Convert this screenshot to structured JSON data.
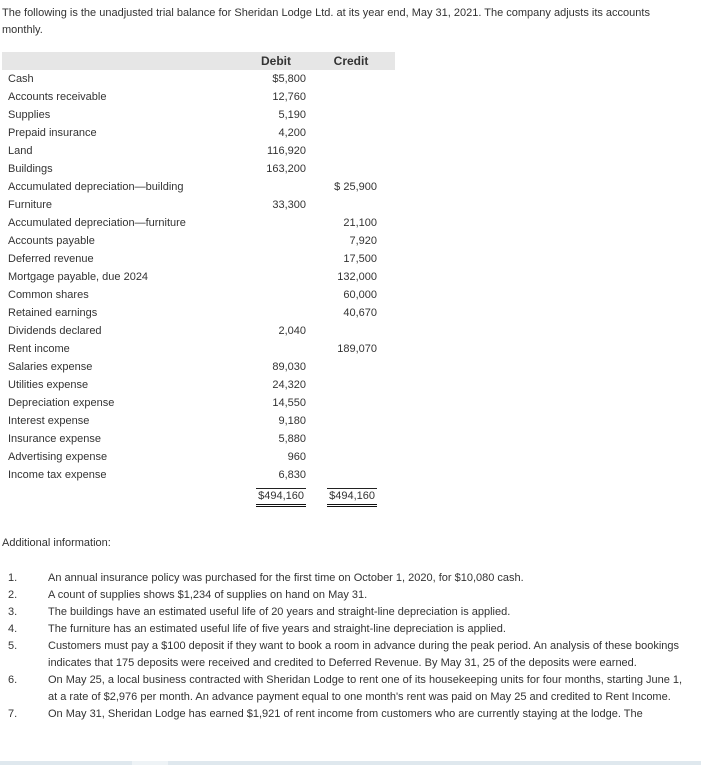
{
  "intro": "The following is the unadjusted trial balance for Sheridan Lodge Ltd. at its year end, May 31, 2021. The company adjusts its accounts monthly.",
  "trial_balance": {
    "headers": {
      "account": "",
      "debit": "Debit",
      "credit": "Credit"
    },
    "rows": [
      {
        "account": "Cash",
        "debit": "$5,800",
        "credit": ""
      },
      {
        "account": "Accounts receivable",
        "debit": "12,760",
        "credit": ""
      },
      {
        "account": "Supplies",
        "debit": "5,190",
        "credit": ""
      },
      {
        "account": "Prepaid insurance",
        "debit": "4,200",
        "credit": ""
      },
      {
        "account": "Land",
        "debit": "116,920",
        "credit": ""
      },
      {
        "account": "Buildings",
        "debit": "163,200",
        "credit": ""
      },
      {
        "account": "Accumulated depreciation—building",
        "debit": "",
        "credit": "$ 25,900"
      },
      {
        "account": "Furniture",
        "debit": "33,300",
        "credit": ""
      },
      {
        "account": "Accumulated depreciation—furniture",
        "debit": "",
        "credit": "21,100"
      },
      {
        "account": "Accounts payable",
        "debit": "",
        "credit": "7,920"
      },
      {
        "account": "Deferred revenue",
        "debit": "",
        "credit": "17,500"
      },
      {
        "account": "Mortgage payable, due 2024",
        "debit": "",
        "credit": "132,000"
      },
      {
        "account": "Common shares",
        "debit": "",
        "credit": "60,000"
      },
      {
        "account": "Retained earnings",
        "debit": "",
        "credit": "40,670"
      },
      {
        "account": "Dividends declared",
        "debit": "2,040",
        "credit": ""
      },
      {
        "account": "Rent income",
        "debit": "",
        "credit": "189,070"
      },
      {
        "account": "Salaries expense",
        "debit": "89,030",
        "credit": ""
      },
      {
        "account": "Utilities expense",
        "debit": "24,320",
        "credit": ""
      },
      {
        "account": "Depreciation expense",
        "debit": "14,550",
        "credit": ""
      },
      {
        "account": "Interest expense",
        "debit": "9,180",
        "credit": ""
      },
      {
        "account": "Insurance expense",
        "debit": "5,880",
        "credit": ""
      },
      {
        "account": "Advertising expense",
        "debit": "960",
        "credit": ""
      },
      {
        "account": "Income tax expense",
        "debit": "6,830",
        "credit": ""
      }
    ],
    "totals": {
      "debit": "$494,160",
      "credit": "$494,160"
    }
  },
  "additional": {
    "heading": "Additional information:",
    "items": [
      {
        "num": "1.",
        "text": "An annual insurance policy was purchased for the first time on October 1, 2020, for $10,080 cash."
      },
      {
        "num": "2.",
        "text": "A count of supplies shows $1,234 of supplies on hand on May 31."
      },
      {
        "num": "3.",
        "text": "The buildings have an estimated useful life of 20 years and straight-line depreciation is applied."
      },
      {
        "num": "4.",
        "text": "The furniture has an estimated useful life of five years and straight-line depreciation is applied."
      },
      {
        "num": "5.",
        "text": "Customers must pay a $100 deposit if they want to book a room in advance during the peak period. An analysis of these bookings indicates that 175 deposits were received and credited to Deferred Revenue. By May 31, 25 of the deposits were earned."
      },
      {
        "num": "6.",
        "text": "On May 25, a local business contracted with Sheridan Lodge to rent one of its housekeeping units for four months, starting June 1, at a rate of $2,976 per month. An advance payment equal to one month's rent was paid on May 25 and credited to Rent Income."
      },
      {
        "num": "7.",
        "text": "On May 31, Sheridan Lodge has earned $1,921 of rent income from customers who are currently staying at the lodge. The"
      }
    ]
  }
}
